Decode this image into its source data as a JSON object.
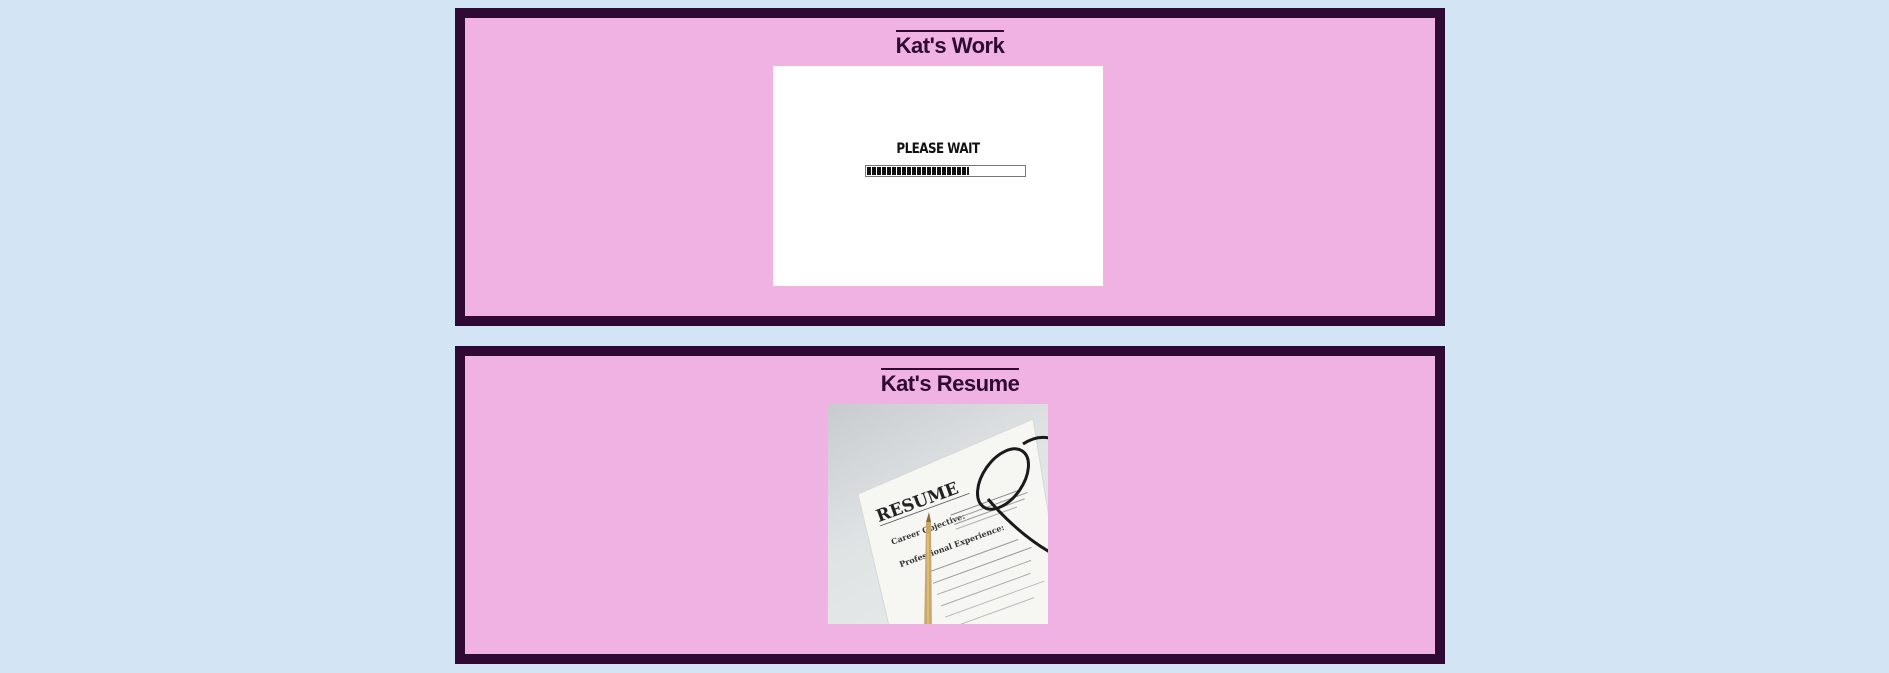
{
  "panels": {
    "work": {
      "title": "Kat's Work",
      "image": {
        "text": "PLEASE WAIT",
        "progress_percent": 65
      }
    },
    "resume": {
      "title": "Kat's Resume",
      "image": {
        "doc_heading": "RESUME",
        "doc_labels": [
          "Career Objective:",
          "Professional Experience:"
        ]
      }
    }
  },
  "colors": {
    "background": "#d3e4f4",
    "panel_border": "#2e0a35",
    "panel_fill": "#efb2e3"
  }
}
